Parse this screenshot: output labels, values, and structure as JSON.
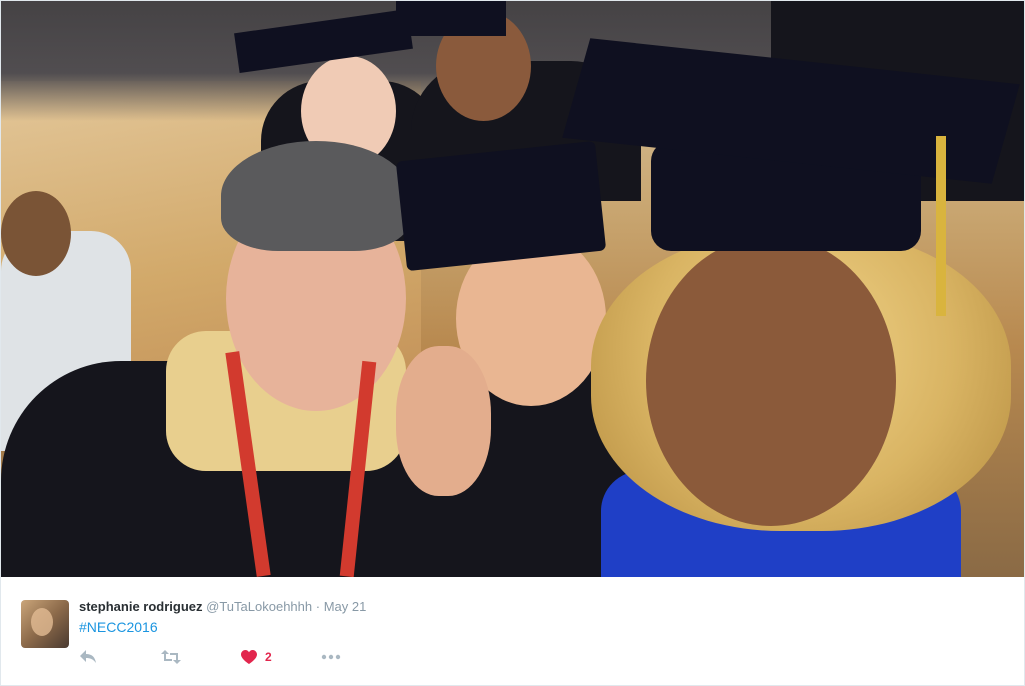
{
  "tweet": {
    "display_name": "stephanie rodriguez",
    "handle": "@TuTaLokoehhhh",
    "separator": "·",
    "date": "May 21",
    "text": "#NECC2016",
    "like_count": "2"
  },
  "icons": {
    "reply": "reply-icon",
    "retweet": "retweet-icon",
    "like": "heart-icon",
    "more": "more-icon"
  },
  "colors": {
    "name": "#292f33",
    "meta": "#8899a6",
    "link": "#1b95e0",
    "like": "#e2264d",
    "icon": "#aab8c2"
  }
}
